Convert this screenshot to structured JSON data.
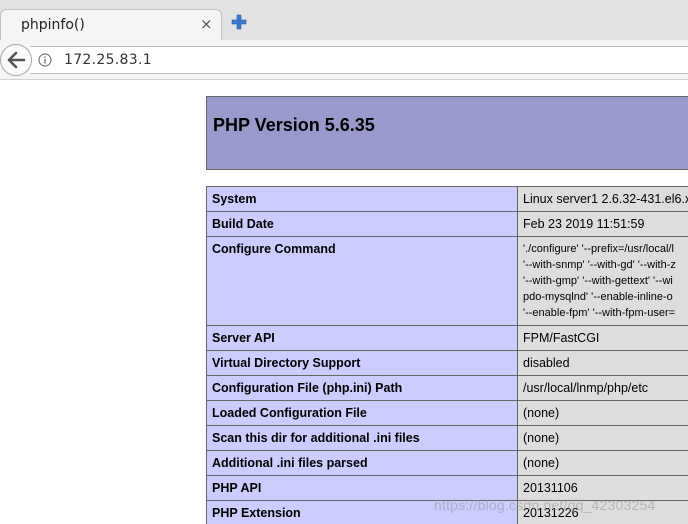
{
  "browser": {
    "tab_title": "phpinfo()",
    "tab_close": "×",
    "url": "172.25.83.1"
  },
  "page": {
    "php_version": "PHP Version 5.6.35",
    "rows": [
      {
        "label": "System",
        "value": "Linux server1 2.6.32-431.el6.x"
      },
      {
        "label": "Build Date",
        "value": "Feb 23 2019 11:51:59"
      },
      {
        "label": "Configure Command",
        "lines": [
          "'./configure' '--prefix=/usr/local/l",
          "'--with-snmp' '--with-gd' '--with-z",
          "'--with-gmp' '--with-gettext' '--wi",
          "pdo-mysqlnd' '--enable-inline-o",
          "'--enable-fpm' '--with-fpm-user="
        ]
      },
      {
        "label": "Server API",
        "value": "FPM/FastCGI"
      },
      {
        "label": "Virtual Directory Support",
        "value": "disabled"
      },
      {
        "label": "Configuration File (php.ini) Path",
        "value": "/usr/local/lnmp/php/etc"
      },
      {
        "label": "Loaded Configuration File",
        "value": "(none)"
      },
      {
        "label": "Scan this dir for additional .ini files",
        "value": "(none)"
      },
      {
        "label": "Additional .ini files parsed",
        "value": "(none)"
      },
      {
        "label": "PHP API",
        "value": "20131106"
      },
      {
        "label": "PHP Extension",
        "value": "20131226"
      }
    ]
  },
  "watermark": "https://blog.csdn.net/qq_42303254",
  "colors": {
    "header_bg": "#9999cc",
    "label_bg": "#ccccff",
    "value_bg": "#dddddd",
    "newtab_icon": "#3a7bd5"
  }
}
